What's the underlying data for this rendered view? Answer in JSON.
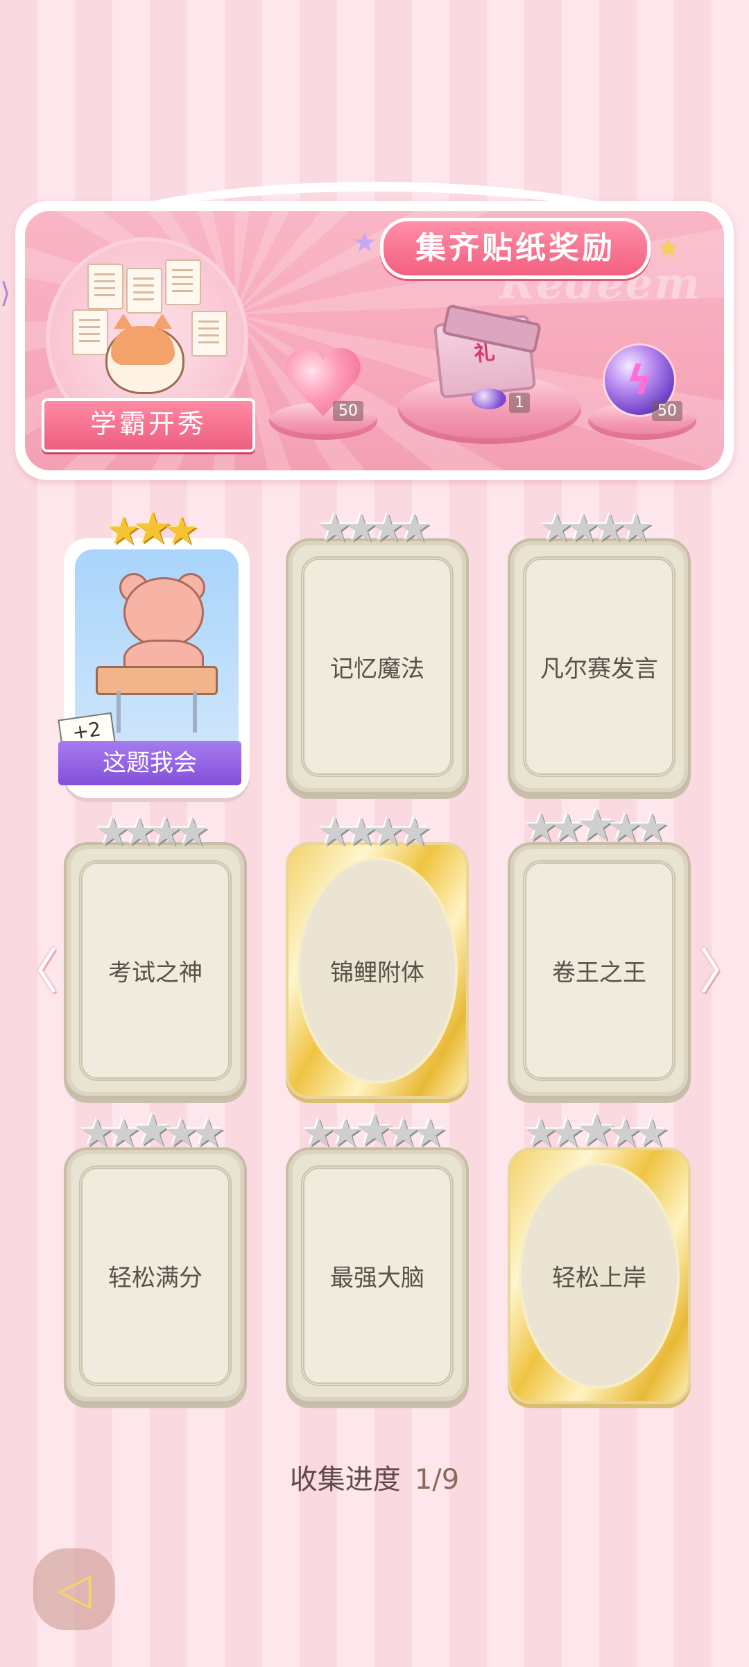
{
  "banner": {
    "title": "集齐贴纸奖励",
    "watermark": "Redeem",
    "badge": "学霸开秀",
    "rewards": [
      {
        "name": "pink-heart-gem",
        "count": "50"
      },
      {
        "name": "gift-box",
        "count": "1"
      },
      {
        "name": "purple-energy-orb",
        "count": "50"
      }
    ]
  },
  "cards": [
    {
      "label": "这题我会",
      "stars": 3,
      "stars_filled": 3,
      "unlocked": true,
      "bonus": "+2"
    },
    {
      "label": "记忆魔法",
      "stars": 4,
      "stars_filled": 0,
      "unlocked": false,
      "style": "plain"
    },
    {
      "label": "凡尔赛发言",
      "stars": 4,
      "stars_filled": 0,
      "unlocked": false,
      "style": "plain"
    },
    {
      "label": "考试之神",
      "stars": 4,
      "stars_filled": 0,
      "unlocked": false,
      "style": "plain"
    },
    {
      "label": "锦鲤附体",
      "stars": 4,
      "stars_filled": 0,
      "unlocked": false,
      "style": "gold"
    },
    {
      "label": "卷王之王",
      "stars": 5,
      "stars_filled": 0,
      "unlocked": false,
      "style": "plain"
    },
    {
      "label": "轻松满分",
      "stars": 5,
      "stars_filled": 0,
      "unlocked": false,
      "style": "plain"
    },
    {
      "label": "最强大脑",
      "stars": 5,
      "stars_filled": 0,
      "unlocked": false,
      "style": "plain"
    },
    {
      "label": "轻松上岸",
      "stars": 5,
      "stars_filled": 0,
      "unlocked": false,
      "style": "gold"
    }
  ],
  "progress": {
    "label": "收集进度",
    "value": "1/9"
  },
  "colors": {
    "accent": "#f2607f",
    "gold_star": "#f6c430",
    "grey_star": "#cfcfcf",
    "purple_ribbon": "#8350d8"
  },
  "icons": {
    "prev": "chevron-left-icon",
    "next": "chevron-right-icon",
    "back": "back-icon",
    "star": "star-icon"
  }
}
